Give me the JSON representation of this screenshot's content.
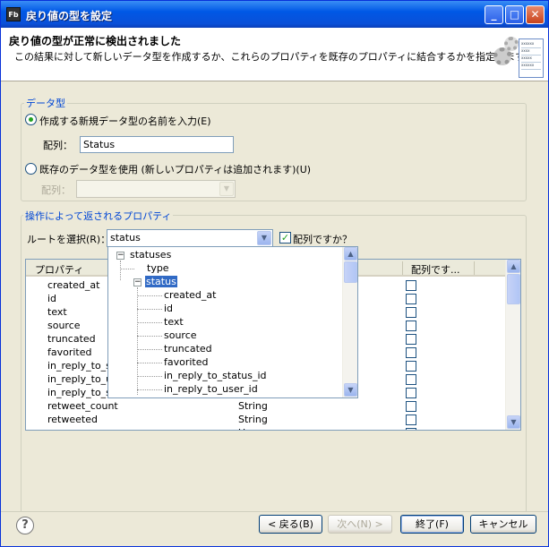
{
  "window": {
    "app_icon": "Fb",
    "title": "戻り値の型を設定",
    "minimize": "_",
    "maximize": "□",
    "close": "✕"
  },
  "header": {
    "title": "戻り値の型が正常に検出されました",
    "description": "この結果に対して新しいデータ型を作成するか、これらのプロパティを既存のプロパティに結合するかを指定します。",
    "banner_icon": "gear-form-icon",
    "banner_lines": [
      "xxxxxx",
      "xxxx",
      "xxxxx",
      "xxxxxx"
    ]
  },
  "datatype_group": {
    "title": "データ型",
    "new_type_radio": "作成する新規データ型の名前を入力(E)",
    "new_array_label": "配列：",
    "new_array_value": "Status",
    "existing_radio": "既存のデータ型を使用 (新しいプロパティは追加されます)(U)",
    "existing_array_label": "配列：",
    "existing_array_value": ""
  },
  "properties_group": {
    "title": "操作によって返されるプロパティ",
    "root_label": "ルートを選択(R)：",
    "root_value": "status",
    "is_array_label": "配列ですか？",
    "is_array_checked": true
  },
  "table": {
    "columns": [
      "プロパティ",
      "",
      "配列です..."
    ],
    "rows": [
      {
        "name": "created_at",
        "type": ""
      },
      {
        "name": "id",
        "type": ""
      },
      {
        "name": "text",
        "type": ""
      },
      {
        "name": "source",
        "type": ""
      },
      {
        "name": "truncated",
        "type": ""
      },
      {
        "name": "favorited",
        "type": ""
      },
      {
        "name": "in_reply_to_sta",
        "type": ""
      },
      {
        "name": "in_reply_to_us",
        "type": ""
      },
      {
        "name": "in_reply_to_sc",
        "type": ""
      },
      {
        "name": "retweet_count",
        "type": "String"
      },
      {
        "name": "retweeted",
        "type": "String"
      },
      {
        "name": "",
        "type": "U"
      }
    ]
  },
  "root_tree": {
    "nodes": [
      {
        "label": "statuses",
        "expander": "⊟"
      },
      {
        "label": "type"
      },
      {
        "label": "status",
        "expander": "⊟",
        "selected": true
      },
      {
        "label": "created_at"
      },
      {
        "label": "id"
      },
      {
        "label": "text"
      },
      {
        "label": "source"
      },
      {
        "label": "truncated"
      },
      {
        "label": "favorited"
      },
      {
        "label": "in_reply_to_status_id"
      },
      {
        "label": "in_reply_to_user_id"
      }
    ]
  },
  "footer": {
    "help": "?",
    "back": "< 戻る(B)",
    "next": "次へ(N) >",
    "finish": "終了(F)",
    "cancel": "キャンセル"
  }
}
